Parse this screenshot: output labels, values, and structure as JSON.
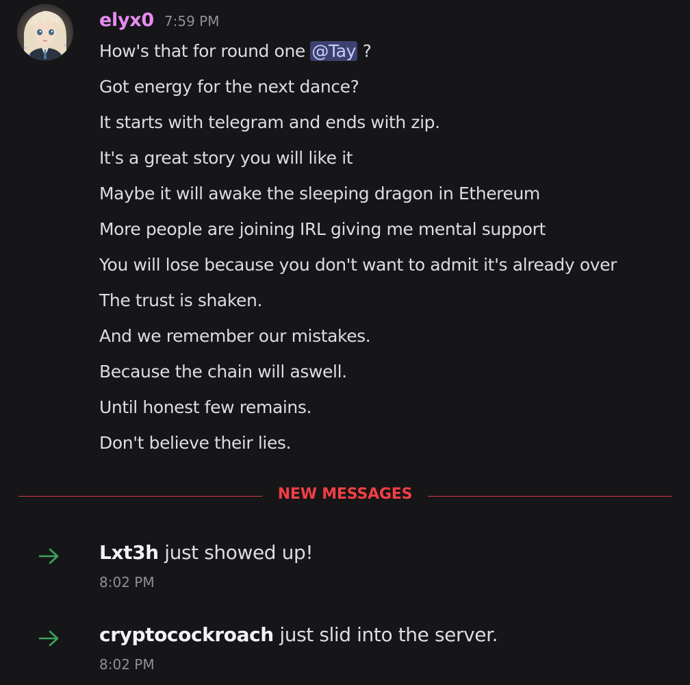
{
  "message": {
    "username": "elyx0",
    "timestamp": "7:59 PM",
    "avatar_icon": "anime-avatar",
    "first_line": {
      "before": "How's that for round one ",
      "mention": "@Tay",
      "after": " ?"
    },
    "lines": [
      "Got energy for the next dance?",
      "It starts with telegram and ends with zip.",
      "It's a great story you will like it",
      "Maybe it will awake the sleeping dragon in Ethereum",
      "More people are joining IRL giving me mental support",
      "You will lose because you don't want to admit it's already over",
      "The trust is shaken.",
      "And we remember our mistakes.",
      "Because the chain will aswell.",
      "Until honest few remains.",
      "Don't believe their lies."
    ]
  },
  "divider": {
    "label": "NEW MESSAGES",
    "color": "#f23f43"
  },
  "joins": [
    {
      "username": "Lxt3h",
      "text": " just showed up!",
      "timestamp": "8:02 PM",
      "icon": "arrow-right-icon"
    },
    {
      "username": "cryptocockroach",
      "text": " just slid into the server.",
      "timestamp": "8:02 PM",
      "icon": "arrow-right-icon"
    }
  ],
  "colors": {
    "background": "#161618",
    "username": "#e98bf2",
    "mention_bg": "#3c4270",
    "join_arrow": "#3ba55d"
  }
}
